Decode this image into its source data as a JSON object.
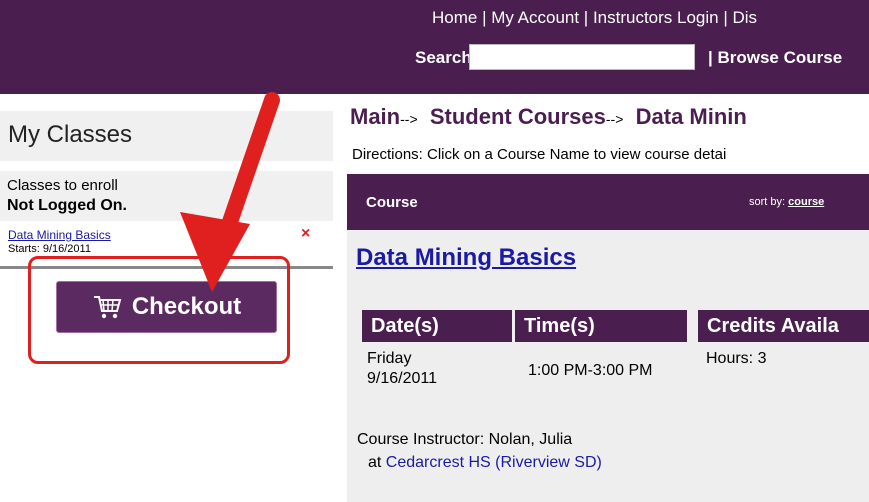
{
  "header": {
    "nav_text": "Home | My Account  | Instructors Login  | Dis",
    "search_label": "Search",
    "search_value": "",
    "browse_label": "| Browse Course"
  },
  "sidebar": {
    "title": "My Classes",
    "enroll_text": "Classes to enroll",
    "status": "Not Logged On.",
    "cart_item": "Data Mining Basics",
    "cart_item_starts": "Starts: 9/16/2011",
    "remove_glyph": "×",
    "checkout_label": "Checkout"
  },
  "breadcrumb": {
    "main": "Main",
    "sep1": "-->",
    "student_courses": "Student Courses",
    "sep2": "-->",
    "current": "Data Minin"
  },
  "directions": "Directions: Click on a Course Name to view course detai",
  "course_table": {
    "header": "Course",
    "sort_label": "sort by:",
    "sort_value": "course"
  },
  "course": {
    "title": "Data Mining Basics",
    "columns": [
      "Date(s)",
      "Time(s)",
      "Credits Availa"
    ],
    "date_line1": "Friday",
    "date_line2": "9/16/2011",
    "time": "1:00 PM-3:00 PM",
    "credits": "Hours: 3",
    "instructor": "Course Instructor: Nolan, Julia",
    "at_label": "at",
    "location": "Cedarcrest HS (Riverview SD)"
  },
  "colors": {
    "brand": "#4a1f4f",
    "annotation": "#e0201f",
    "link": "#1a1aa6"
  }
}
